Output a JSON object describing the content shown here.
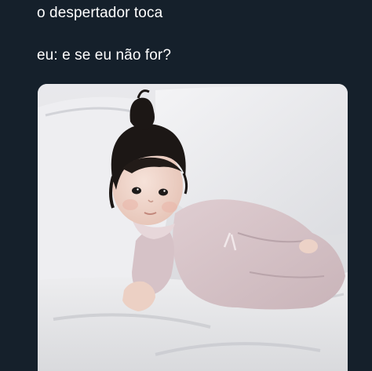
{
  "tweet": {
    "lines": [
      "o despertador toca",
      "eu: e se eu não for?"
    ]
  },
  "media": {
    "subject": "photo",
    "colors": {
      "background": "#15202b",
      "text": "#ffffff",
      "sheets": "#e8e8ea",
      "pajamas": "#d8c5c9",
      "hair": "#1c1715",
      "skin": "#efd6cc"
    }
  }
}
